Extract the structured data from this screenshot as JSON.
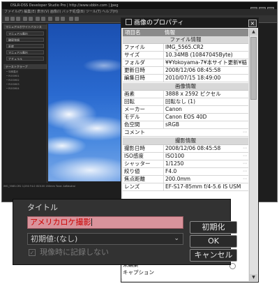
{
  "app": {
    "title": "DSLR-DSS Developer Studio Pro | http://www.sbbin.com | Jpeg",
    "menu": "ファイル(F)  編集(E)  表示(V)  画像(I)  バッチ処理(B)  ツール(T)  ヘルプ(H)",
    "status": "IMG_5565.CR2  1/250  F4.0  ISO100  200mm  Tone: AdNeutral"
  },
  "left_panel": {
    "header": "マニュアルホワイトバランス",
    "rows": [
      "マニュアル露出",
      "輪郭強調",
      "彩度",
      "マニュアル露出",
      "ナチュラル"
    ],
    "section2": "ナチュラル",
    "section3": "テーストクラーブ",
    "small_items": [
      "• 特殊露光",
      "• ROOM01",
      "• ROOM02",
      "• ROOM03",
      "• ROOM04"
    ]
  },
  "properties_dialog": {
    "title": "画像のプロパティ",
    "close_label": "×",
    "header": {
      "key": "項目名",
      "value": "情報"
    },
    "sections": [
      {
        "title": "ファイル情報",
        "rows": [
          {
            "key": "ファイル",
            "value": "IMG_5565.CR2"
          },
          {
            "key": "サイズ",
            "value": "10.34MB (10847045Byte)"
          },
          {
            "key": "フォルダ",
            "value": "¥¥Yokoyama-7¥本サイト更新¥稲"
          },
          {
            "key": "更新日時",
            "value": "2008/12/06 08:45:58"
          },
          {
            "key": "編集日時",
            "value": "2010/07/15 18:49:00"
          }
        ]
      },
      {
        "title": "画像情報",
        "rows": [
          {
            "key": "画素",
            "value": "3888 x 2592 ピクセル"
          },
          {
            "key": "回転",
            "value": "回転なし (1)"
          },
          {
            "key": "メーカー",
            "value": "Canon"
          },
          {
            "key": "モデル",
            "value": "Canon EOS 40D"
          },
          {
            "key": "色空間",
            "value": "sRGB"
          },
          {
            "key": "コメント",
            "value": ""
          }
        ]
      },
      {
        "title": "撮影情報",
        "rows": [
          {
            "key": "撮影日時",
            "value": "2008/12/06 08:45:58"
          },
          {
            "key": "ISO感度",
            "value": "ISO100"
          },
          {
            "key": "シャッター",
            "value": "1/1250"
          },
          {
            "key": "絞り値",
            "value": "F4.0"
          },
          {
            "key": "焦点距離",
            "value": "200.0mm"
          },
          {
            "key": "レンズ",
            "value": "EF-S17-85mm f/4-5.6 IS USM"
          }
        ]
      }
    ],
    "list_tail": [
      "未編集",
      "キャプション"
    ]
  },
  "popup": {
    "label": "タイトル",
    "input_value": "アメリカロケ撮影",
    "select_value": "初期値:(なし)",
    "checkbox_label": "現像時に記録しない",
    "buttons": {
      "reset": "初期化",
      "ok": "OK",
      "cancel": "キャンセル"
    }
  }
}
